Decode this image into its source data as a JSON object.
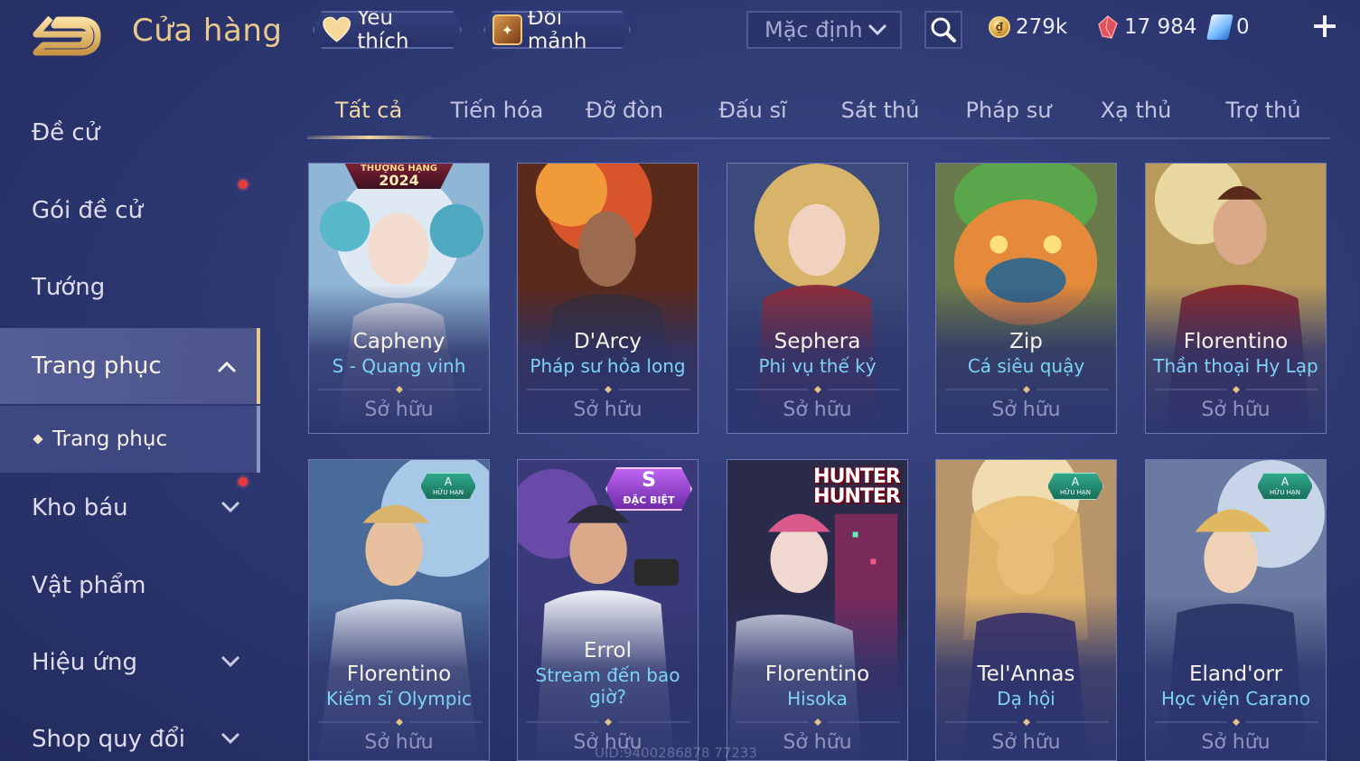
{
  "header": {
    "title": "Cửa hàng",
    "favorite_label": "Yêu thích",
    "exchange_label": "Đổi mảnh",
    "sort_value": "Mặc định",
    "gold": "279k",
    "vouchers": "17 984",
    "quan_huy": "0"
  },
  "sidebar": {
    "items": [
      {
        "label": "Đề cử"
      },
      {
        "label": "Gói đề cử"
      },
      {
        "label": "Tướng"
      },
      {
        "label": "Trang phục"
      },
      {
        "label": "Kho báu"
      },
      {
        "label": "Vật phẩm"
      },
      {
        "label": "Hiệu ứng"
      },
      {
        "label": "Shop quy đổi"
      }
    ],
    "subitem": "Trang phục"
  },
  "tabs": [
    "Tất cả",
    "Tiến hóa",
    "Đỡ đòn",
    "Đấu sĩ",
    "Sát thủ",
    "Pháp sư",
    "Xạ thủ",
    "Trợ thủ"
  ],
  "cards": [
    {
      "hero": "Capheny",
      "skin": "S - Quang vinh",
      "status": "Sở hữu",
      "rank_top": "THƯỢNG HẠNG",
      "rank_year": "2024"
    },
    {
      "hero": "D'Arcy",
      "skin": "Pháp sư hỏa long",
      "status": "Sở hữu"
    },
    {
      "hero": "Sephera",
      "skin": "Phi vụ thế kỷ",
      "status": "Sở hữu"
    },
    {
      "hero": "Zip",
      "skin": "Cá siêu quậy",
      "status": "Sở hữu"
    },
    {
      "hero": "Florentino",
      "skin": "Thần thoại Hy Lạp",
      "status": "Sở hữu"
    },
    {
      "hero": "Florentino",
      "skin": "Kiếm sĩ Olympic",
      "status": "Sở hữu",
      "badge": "A",
      "badge_sub": "HỮU HẠN"
    },
    {
      "hero": "Errol",
      "skin": "Stream đến bao giờ?",
      "status": "Sở hữu",
      "badge": "S",
      "badge_sub": "ĐẶC BIỆT"
    },
    {
      "hero": "Florentino",
      "skin": "Hisoka",
      "status": "Sở hữu",
      "logo": "HUNTER"
    },
    {
      "hero": "Tel'Annas",
      "skin": "Dạ hội",
      "status": "Sở hữu",
      "badge": "A",
      "badge_sub": "HỮU HẠN"
    },
    {
      "hero": "Eland'orr",
      "skin": "Học viện Carano",
      "status": "Sở hữu",
      "badge": "A",
      "badge_sub": "HỮU HẠN"
    }
  ],
  "uid": "UID:9400286878 77233",
  "colors": {
    "accent": "#e9c98d",
    "skin_text": "#7cd3f5",
    "notification": "#e83a3a"
  }
}
